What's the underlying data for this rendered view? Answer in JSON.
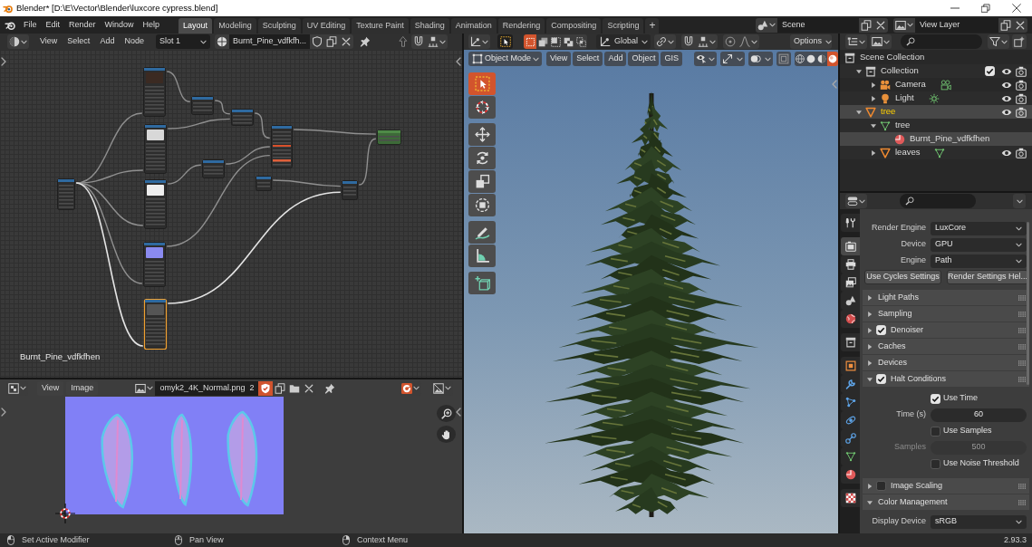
{
  "title_bar": {
    "title": "Blender* [D:\\E\\Vector\\Blender\\luxcore cypress.blend]"
  },
  "top_bar": {
    "menus": [
      "File",
      "Edit",
      "Render",
      "Window",
      "Help"
    ],
    "workspaces": [
      {
        "label": "Layout",
        "selected": true
      },
      {
        "label": "Modeling",
        "selected": false
      },
      {
        "label": "Sculpting",
        "selected": false
      },
      {
        "label": "UV Editing",
        "selected": false
      },
      {
        "label": "Texture Paint",
        "selected": false
      },
      {
        "label": "Shading",
        "selected": false
      },
      {
        "label": "Animation",
        "selected": false
      },
      {
        "label": "Rendering",
        "selected": false
      },
      {
        "label": "Compositing",
        "selected": false
      },
      {
        "label": "Scripting",
        "selected": false
      }
    ],
    "add_workspace": "+",
    "scene": "Scene",
    "view_layer": "View Layer"
  },
  "node_editor": {
    "menus": [
      "View",
      "Select",
      "Add",
      "Node"
    ],
    "slot": "Slot 1",
    "material": "Burnt_Pine_vdfkfh...",
    "fake_user": false,
    "nodes": [
      {
        "kind": "input",
        "selected": false
      },
      {
        "kind": "image",
        "selected": false
      },
      {
        "kind": "image",
        "selected": false
      },
      {
        "kind": "image",
        "selected": false
      },
      {
        "kind": "image",
        "selected": false
      },
      {
        "kind": "image",
        "selected": true
      },
      {
        "kind": "utility",
        "selected": false
      },
      {
        "kind": "utility",
        "selected": false
      },
      {
        "kind": "utility",
        "selected": false
      },
      {
        "kind": "shader",
        "selected": false
      },
      {
        "kind": "utility",
        "selected": false
      },
      {
        "kind": "utility",
        "selected": false
      },
      {
        "kind": "output",
        "selected": false
      }
    ],
    "material_label": "Burnt_Pine_vdfkfhen"
  },
  "viewport": {
    "tool_header": {
      "select_modes": [
        {
          "kind": "set",
          "selected": true
        },
        {
          "kind": "extend",
          "selected": false
        },
        {
          "kind": "subtract",
          "selected": false
        },
        {
          "kind": "difference",
          "selected": false
        },
        {
          "kind": "intersect",
          "selected": false
        }
      ],
      "orientation": "Global",
      "options": "Options"
    },
    "header": {
      "mode": "Object Mode",
      "menus": [
        "View",
        "Select",
        "Add",
        "Object",
        "GIS"
      ],
      "shading": [
        {
          "kind": "wireframe",
          "selected": false
        },
        {
          "kind": "solid",
          "selected": false
        },
        {
          "kind": "material",
          "selected": false
        },
        {
          "kind": "rendered",
          "selected": true
        }
      ]
    },
    "tool_groups": [
      {
        "tools": [
          {
            "kind": "select_box",
            "selected": true
          },
          {
            "kind": "cursor",
            "selected": false
          }
        ]
      },
      {
        "tools": [
          {
            "kind": "move",
            "selected": false
          },
          {
            "kind": "rotate",
            "selected": false
          },
          {
            "kind": "scale",
            "selected": false
          },
          {
            "kind": "transform",
            "selected": false
          }
        ]
      },
      {
        "tools": [
          {
            "kind": "annotate",
            "selected": false
          },
          {
            "kind": "measure",
            "selected": false
          }
        ]
      },
      {
        "tools": [
          {
            "kind": "add_cube",
            "selected": false
          }
        ]
      }
    ]
  },
  "outliner": {
    "items": [
      {
        "label": "Scene Collection",
        "kind": "scene_collection",
        "toggles": false,
        "selected": false,
        "active": false,
        "children": [
          {
            "label": "Collection",
            "kind": "collection",
            "expanded": true,
            "checked": true,
            "toggles": true,
            "selected": false,
            "active": false,
            "children": [
              {
                "label": "Camera",
                "kind": "camera",
                "expanded": false,
                "data": {
                  "kind": "camera"
                },
                "toggles": true,
                "selected": false,
                "active": false
              },
              {
                "label": "Light",
                "kind": "light",
                "expanded": false,
                "data": {
                  "kind": "light"
                },
                "toggles": true,
                "selected": false,
                "active": false
              }
            ]
          },
          {
            "label": "tree",
            "kind": "mesh_object",
            "expanded": true,
            "toggles": true,
            "selected": true,
            "active": true,
            "children": [
              {
                "label": "tree",
                "kind": "mesh_data",
                "expanded": true,
                "toggles": false,
                "selected": false,
                "active": false,
                "children": [
                  {
                    "label": "Burnt_Pine_vdfkfhen",
                    "kind": "material",
                    "toggles": false,
                    "selected": true,
                    "active": false
                  }
                ]
              },
              {
                "label": "leaves",
                "kind": "mesh_object",
                "expanded": false,
                "data": {
                  "kind": "mesh_data"
                },
                "toggles": true,
                "selected": false,
                "active": false
              }
            ]
          }
        ]
      }
    ]
  },
  "properties": {
    "tab_groups": [
      {
        "tabs": [
          {
            "kind": "tool",
            "selected": false
          }
        ]
      },
      {
        "tabs": [
          {
            "kind": "render",
            "selected": true
          },
          {
            "kind": "output",
            "selected": false
          },
          {
            "kind": "view_layer",
            "selected": false
          },
          {
            "kind": "scene",
            "selected": false
          },
          {
            "kind": "world",
            "selected": false
          }
        ]
      },
      {
        "tabs": [
          {
            "kind": "collection",
            "selected": false
          }
        ]
      },
      {
        "tabs": [
          {
            "kind": "object",
            "selected": false
          },
          {
            "kind": "modifiers",
            "selected": false
          },
          {
            "kind": "particles",
            "selected": false
          },
          {
            "kind": "physics",
            "selected": false
          },
          {
            "kind": "constraints",
            "selected": false
          },
          {
            "kind": "data",
            "selected": false
          },
          {
            "kind": "material",
            "selected": false
          }
        ]
      },
      {
        "tabs": [
          {
            "kind": "texture",
            "selected": false
          }
        ]
      }
    ],
    "fields": [
      {
        "label": "Render Engine",
        "value": "LuxCore"
      },
      {
        "label": "Device",
        "value": "GPU"
      },
      {
        "label": "Engine",
        "value": "Path"
      }
    ],
    "buttons": [
      "Use Cycles Settings",
      "Render Settings Hel..."
    ],
    "panels": [
      {
        "title": "Light Paths",
        "kind": "plain",
        "expanded": false
      },
      {
        "title": "Sampling",
        "kind": "plain",
        "expanded": false
      },
      {
        "title": "Denoiser",
        "kind": "toggle",
        "checked": true,
        "expanded": false
      },
      {
        "title": "Caches",
        "kind": "plain",
        "expanded": false
      },
      {
        "title": "Devices",
        "kind": "plain",
        "expanded": false
      },
      {
        "title": "Halt Conditions",
        "kind": "toggle",
        "checked": true,
        "expanded": true,
        "rows": [
          {
            "kind": "checkbox",
            "label": "Use Time",
            "checked": true
          },
          {
            "kind": "number",
            "label": "Time (s)",
            "value": "60",
            "disabled": false
          },
          {
            "kind": "checkbox",
            "label": "Use Samples",
            "checked": false
          },
          {
            "kind": "number",
            "label": "Samples",
            "value": "500",
            "disabled": true
          },
          {
            "kind": "checkbox",
            "label": "Use Noise Threshold",
            "checked": false
          }
        ]
      },
      {
        "title": "Image Scaling",
        "kind": "toggle",
        "checked": false,
        "expanded": false
      },
      {
        "title": "Color Management",
        "kind": "plain",
        "expanded": true,
        "rows": [
          {
            "kind": "dropdown",
            "label": "Display Device",
            "value": "sRGB"
          }
        ]
      }
    ]
  },
  "image_editor": {
    "menus": [
      "View",
      "Image"
    ],
    "image": "omyk2_4K_Normal.png",
    "users": "2",
    "fake_user": true
  },
  "status_bar": {
    "hints": [
      {
        "kind": "left",
        "label": "Set Active Modifier"
      },
      {
        "kind": "middle",
        "label": "Pan View"
      },
      {
        "kind": "right",
        "label": "Context Menu"
      }
    ],
    "version": "2.93.3"
  }
}
